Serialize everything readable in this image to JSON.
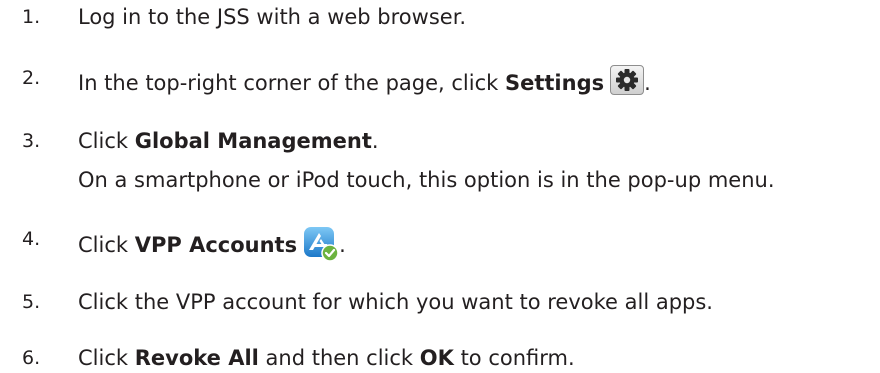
{
  "steps": [
    {
      "number": "1.",
      "before": "Log in to the JSS with a web browser.",
      "bold": "",
      "after": ""
    },
    {
      "number": "2.",
      "before": "In the top-right corner of the page, click ",
      "bold": "Settings",
      "icon": "gear-icon",
      "after": "."
    },
    {
      "number": "3.",
      "before": "Click ",
      "bold": "Global Management",
      "after": ".",
      "note": "On a smartphone or iPod touch, this option is in the pop-up menu."
    },
    {
      "number": "4.",
      "before": "Click ",
      "bold": "VPP Accounts",
      "icon": "app-store-check-icon",
      "after": "."
    },
    {
      "number": "5.",
      "before": "Click the VPP account for which you want to revoke all apps.",
      "bold": "",
      "after": ""
    },
    {
      "number": "6.",
      "before": "Click ",
      "bold": "Revoke All",
      "middle": " and then click ",
      "bold2": "OK",
      "after": " to confirm."
    }
  ]
}
